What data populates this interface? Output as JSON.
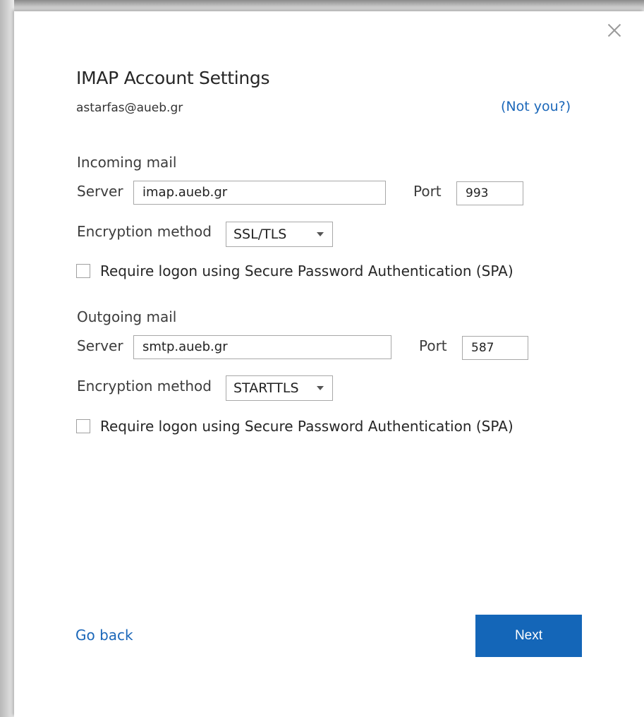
{
  "dialog": {
    "title": "IMAP Account Settings",
    "email": "astarfas@aueb.gr",
    "not_you_label": "(Not you?)"
  },
  "incoming": {
    "section_title": "Incoming mail",
    "server_label": "Server",
    "server_value": "imap.aueb.gr",
    "port_label": "Port",
    "port_value": "993",
    "encryption_label": "Encryption method",
    "encryption_value": "SSL/TLS",
    "spa_label": "Require logon using Secure Password Authentication (SPA)",
    "spa_checked": false
  },
  "outgoing": {
    "section_title": "Outgoing mail",
    "server_label": "Server",
    "server_value": "smtp.aueb.gr",
    "port_label": "Port",
    "port_value": "587",
    "encryption_label": "Encryption method",
    "encryption_value": "STARTTLS",
    "spa_label": "Require logon using Secure Password Authentication (SPA)",
    "spa_checked": false
  },
  "footer": {
    "go_back_label": "Go back",
    "next_label": "Next"
  },
  "colors": {
    "accent": "#1466b8",
    "link": "#1b67b9"
  },
  "icons": {
    "close": "close-icon",
    "dropdown": "chevron-down-icon"
  }
}
